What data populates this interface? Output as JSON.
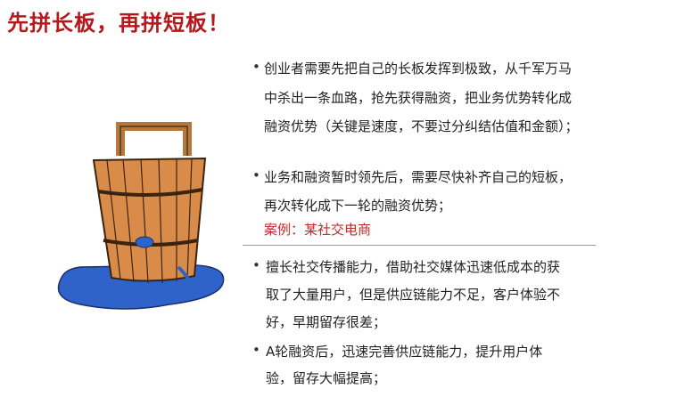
{
  "title": "先拼长板，再拼短板！",
  "colors": {
    "title": "#b3191e",
    "case": "#c8262b",
    "wood": "#d98c4a",
    "water": "#2f63c9"
  },
  "image": {
    "icon": "leaking-wooden-bucket-illustration"
  },
  "section1": {
    "bullets": [
      {
        "lines": [
          "创业者需要先把自己的长板发挥到极致，从千军万马",
          "中杀出一条血路，抢先获得融资，把业务优势转化成",
          "融资优势（关键是速度，不要过分纠结估值和金额）；"
        ]
      },
      {
        "lines": [
          "业务和融资暂时领先后，需要尽快补齐自己的短板，",
          "再次转化成下一轮的融资优势；"
        ]
      }
    ],
    "case_label": "案例：某社交电商"
  },
  "section2": {
    "bullets": [
      {
        "lines": [
          "擅长社交传播能力，借助社交媒体迅速低成本的获",
          "取了大量用户，但是供应链能力不足，客户体验不",
          "好，早期留存很差；"
        ]
      },
      {
        "lines": [
          "A轮融资后，迅速完善供应链能力，提升用户体",
          "验，留存大幅提高；"
        ]
      }
    ]
  }
}
